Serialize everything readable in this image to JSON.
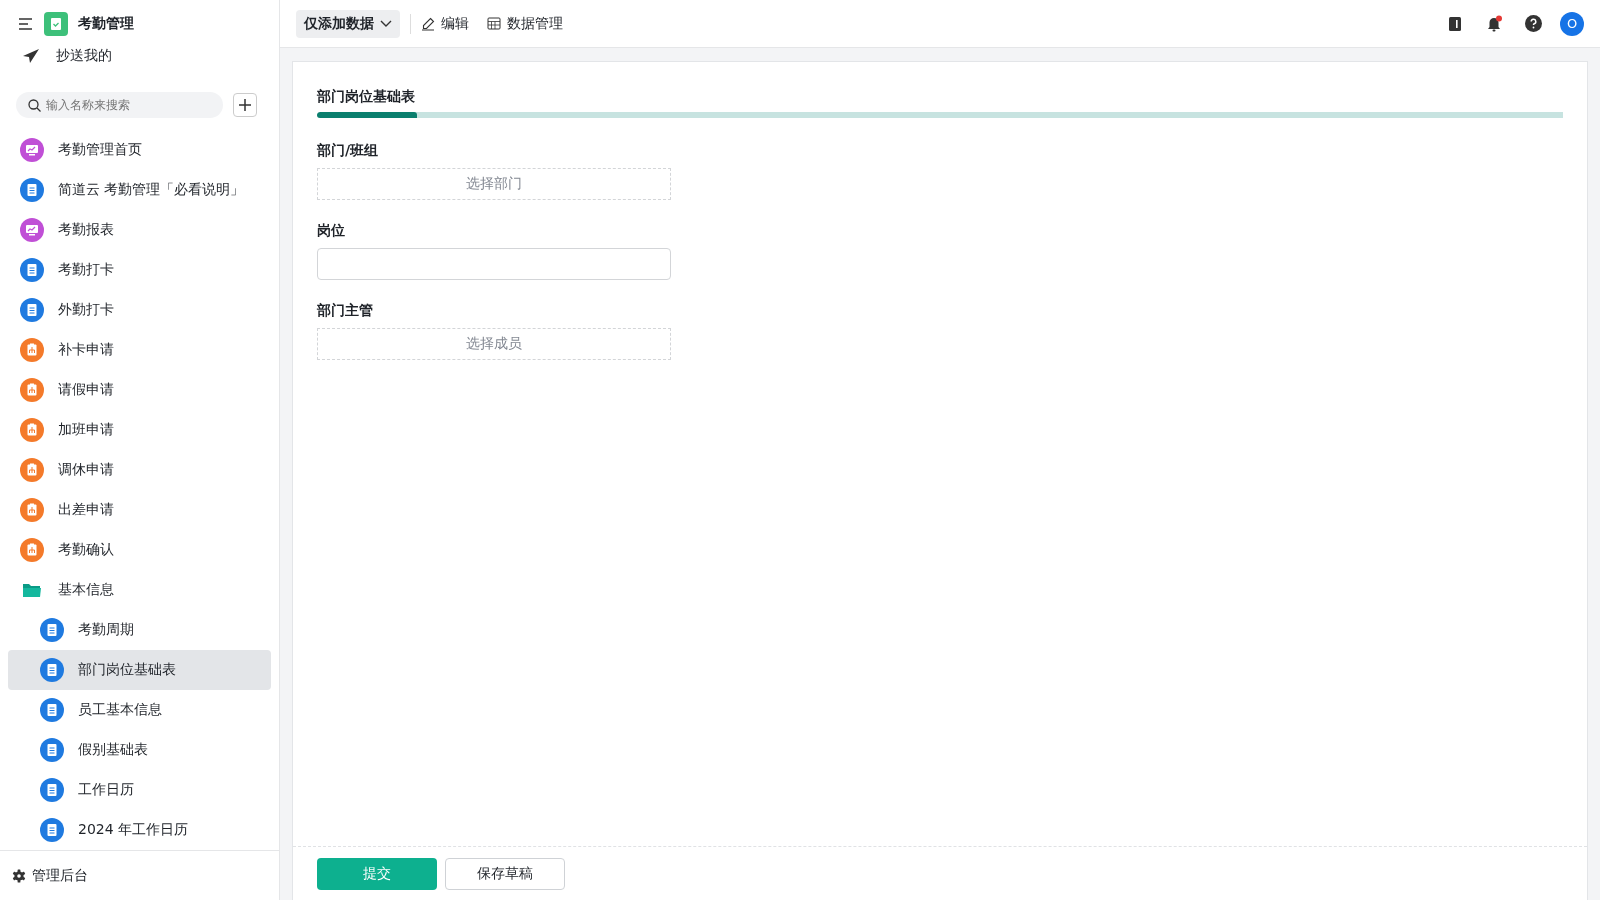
{
  "app": {
    "title": "考勤管理"
  },
  "cc_link": "抄送我的",
  "search": {
    "placeholder": "输入名称来搜索"
  },
  "nav": [
    {
      "label": "考勤管理首页",
      "kind": "dashboard",
      "selected": false
    },
    {
      "label": "简道云 考勤管理「必看说明」",
      "kind": "form",
      "selected": false
    },
    {
      "label": "考勤报表",
      "kind": "dashboard",
      "selected": false
    },
    {
      "label": "考勤打卡",
      "kind": "form",
      "selected": false
    },
    {
      "label": "外勤打卡",
      "kind": "form",
      "selected": false
    },
    {
      "label": "补卡申请",
      "kind": "flow",
      "selected": false
    },
    {
      "label": "请假申请",
      "kind": "flow",
      "selected": false
    },
    {
      "label": "加班申请",
      "kind": "flow",
      "selected": false
    },
    {
      "label": "调休申请",
      "kind": "flow",
      "selected": false
    },
    {
      "label": "出差申请",
      "kind": "flow",
      "selected": false
    },
    {
      "label": "考勤确认",
      "kind": "flow",
      "selected": false
    },
    {
      "label": "基本信息",
      "kind": "folder",
      "selected": false,
      "children": [
        {
          "label": "考勤周期",
          "kind": "form",
          "selected": false
        },
        {
          "label": "部门岗位基础表",
          "kind": "form",
          "selected": true
        },
        {
          "label": "员工基本信息",
          "kind": "form",
          "selected": false
        },
        {
          "label": "假别基础表",
          "kind": "form",
          "selected": false
        },
        {
          "label": "工作日历",
          "kind": "form",
          "selected": false
        },
        {
          "label": "2024 年工作日历",
          "kind": "form",
          "selected": false
        }
      ]
    }
  ],
  "admin_link": "管理后台",
  "toolbar": {
    "mode": "仅添加数据",
    "edit": "编辑",
    "data": "数据管理"
  },
  "user": {
    "initial": "O"
  },
  "notifications": {
    "unread": true
  },
  "form": {
    "title": "部门岗位基础表",
    "progress": {
      "level": 0.08
    },
    "fields": [
      {
        "label": "部门/班组",
        "kind": "picker",
        "placeholder": "选择部门"
      },
      {
        "label": "岗位",
        "kind": "input"
      },
      {
        "label": "部门主管",
        "kind": "picker",
        "placeholder": "选择成员"
      }
    ],
    "submit": "提交",
    "save_draft": "保存草稿"
  }
}
